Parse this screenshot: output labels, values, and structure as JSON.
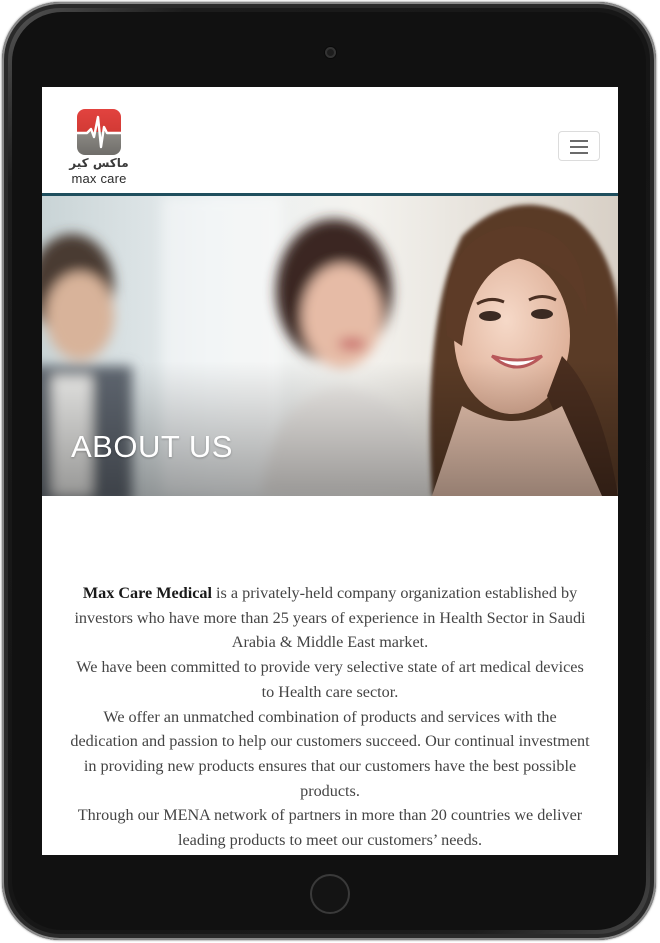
{
  "brand": {
    "logo_arabic": "ماكس كير",
    "logo_english": "max care",
    "colors": {
      "logo_red": "#e2433f",
      "logo_gray": "#77746f",
      "navbar_border": "#1f4f5e"
    }
  },
  "navbar": {
    "menu_icon": "hamburger-menu-icon"
  },
  "hero": {
    "title": "ABOUT US"
  },
  "about": {
    "company_name": "Max Care Medical",
    "p1_rest": " is a privately-held company organization established by investors who have more than 25 years of experience in Health Sector in Saudi Arabia & Middle East market.",
    "p2": "We have been committed to provide very selective state of art medical devices to Health care sector.",
    "p3": "We offer an unmatched combination of products and services with the dedication and passion to help our customers succeed. Our continual investment in providing new products ensures that our customers have the best possible products.",
    "p4": "Through our MENA network of partners in more than 20 countries we deliver leading products to meet our customers’ needs."
  }
}
